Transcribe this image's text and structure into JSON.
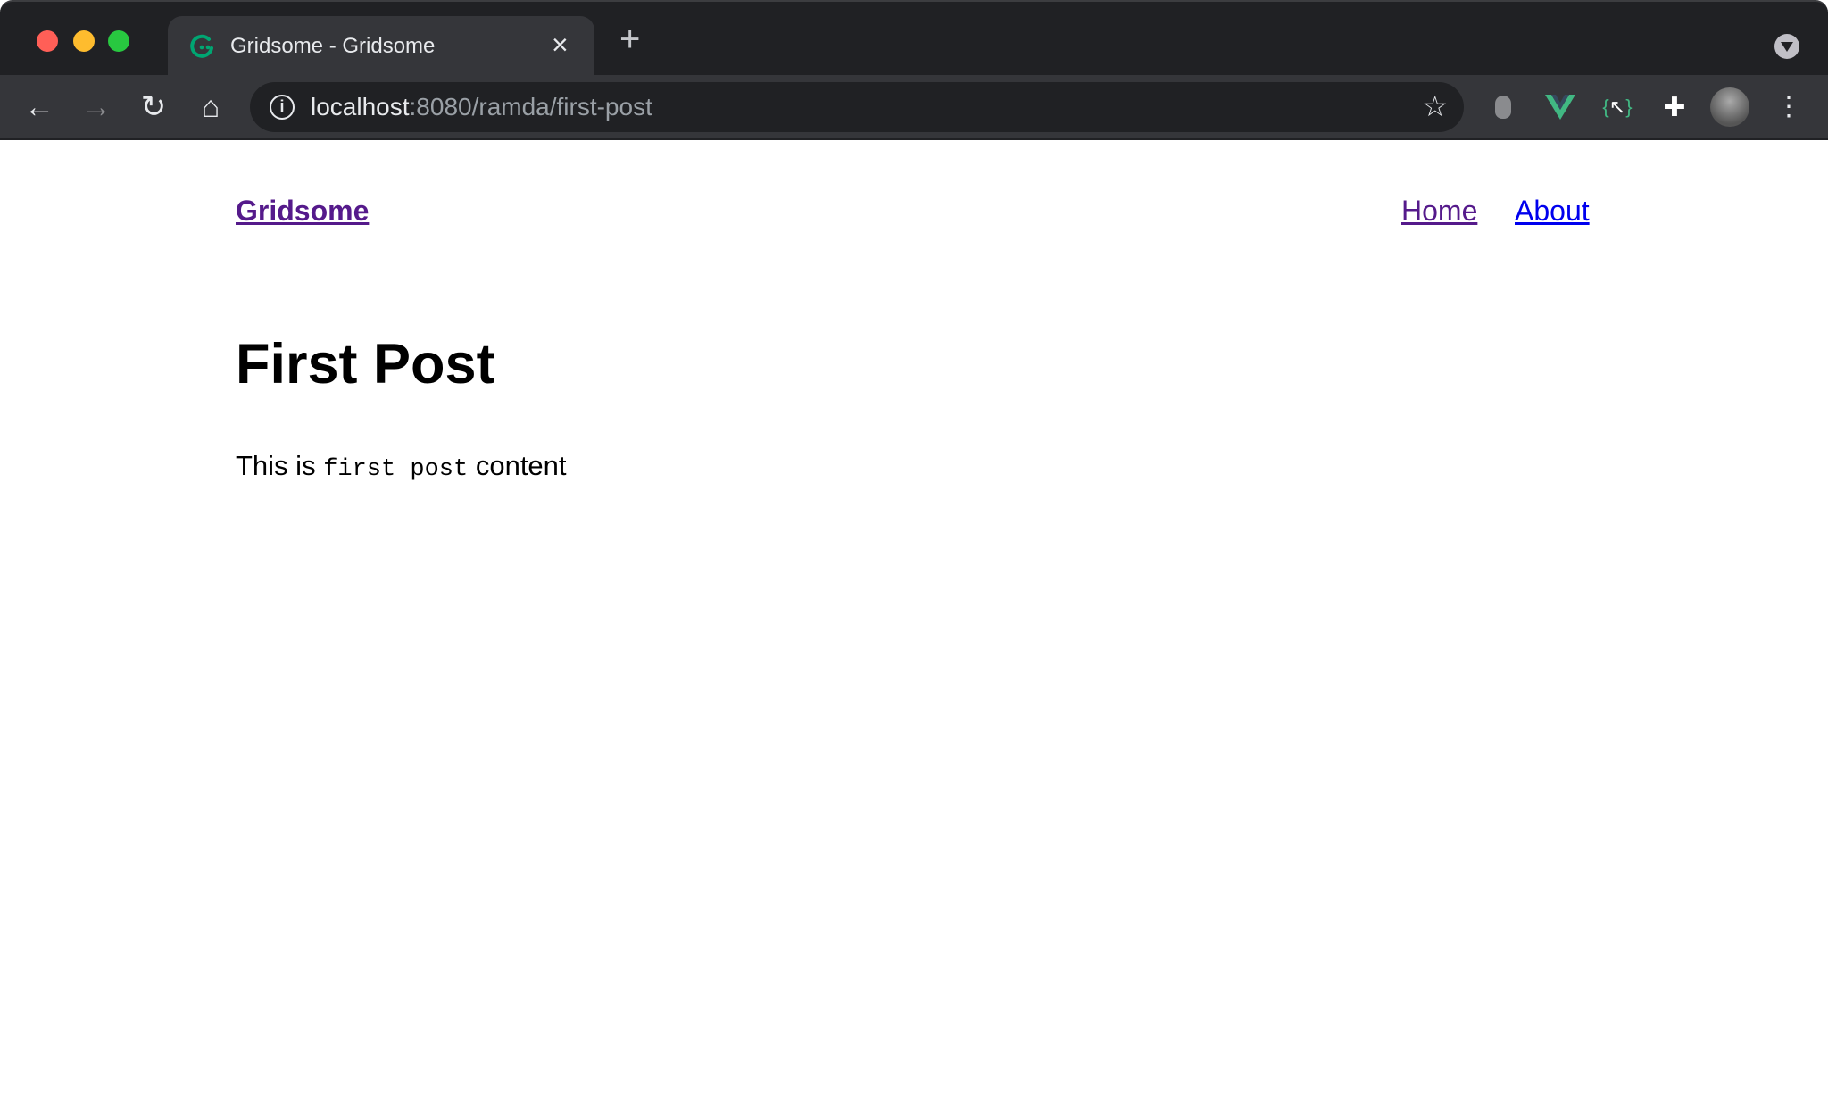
{
  "browser": {
    "tab_title": "Gridsome - Gridsome",
    "url_host": "localhost",
    "url_rest": ":8080/ramda/first-post",
    "close_symbol": "×",
    "newtab_symbol": "+",
    "colors": {
      "frame": "#202124",
      "toolbar": "#35363a",
      "close": "#ff5f57",
      "minimize": "#febc2e",
      "maximize": "#28c840",
      "gridsome_green": "#00a672"
    }
  },
  "site": {
    "logo": "Gridsome",
    "nav": [
      "Home",
      "About"
    ],
    "title": "First Post",
    "content": {
      "before": "This is ",
      "code": "first post",
      "after": " content"
    },
    "colors": {
      "visited_link": "#551a8b",
      "link": "#0000ee"
    }
  }
}
